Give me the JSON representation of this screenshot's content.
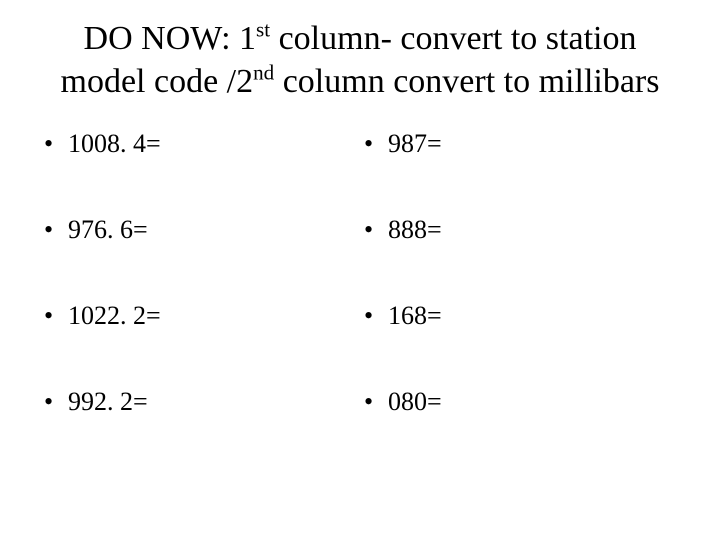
{
  "title": {
    "prefix": "DO NOW: 1",
    "sup1": "st",
    "mid1": " column- convert to station model code /2",
    "sup2": "nd",
    "mid2": " column convert to millibars"
  },
  "left_column": [
    "1008. 4=",
    "976. 6=",
    "1022. 2=",
    "992. 2="
  ],
  "right_column": [
    "987=",
    "888=",
    "168=",
    "080="
  ]
}
